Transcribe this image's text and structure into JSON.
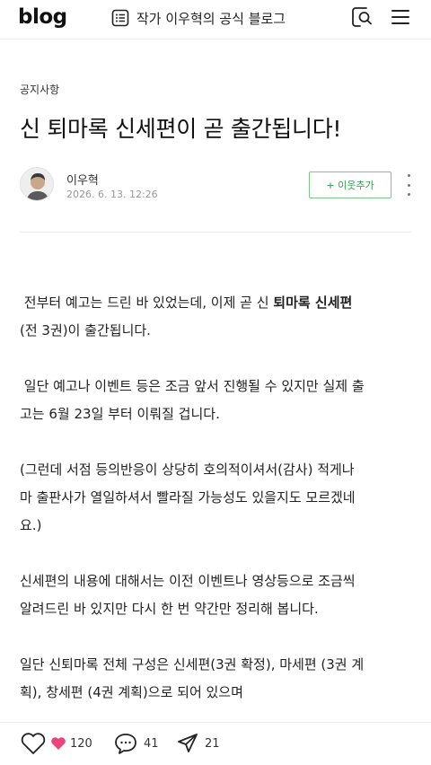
{
  "header": {
    "logo": "blog",
    "blog_title": "작가 이우혁의 공식 블로그"
  },
  "post": {
    "category": "공지사항",
    "title": "신 퇴마록 신세편이 곧 출간됩니다!",
    "author": "이우혁",
    "date": "2026. 6. 13. 12:26",
    "neighbor_button": "+ 이웃추가"
  },
  "body": {
    "p1_l1_a": " 전부터 예고는 드린 바 있었는데, 이제 곧 신 ",
    "p1_l1_b": "퇴마록 신세편",
    "p1_l2": "(전 3권)이 출간됩니다.",
    "p2_l1": " 일단 예고나 이벤트 등은 조금 앞서 진행될 수 있지만 실제 출",
    "p2_l2": "고는 6월 23일 부터 이뤄질 겁니다.",
    "p3_l1": "(그런데 서점 등의반응이 상당히 호의적이셔서(감사) 적게나",
    "p3_l2": "마 출판사가 열일하셔서 빨라질 가능성도 있을지도 모르겠네",
    "p3_l3": "요.)",
    "p4_l1": "신세편의 내용에 대해서는 이전 이벤트나 영상등으로 조금씩",
    "p4_l2": "알려드린 바 있지만 다시 한 번 약간만 정리해 봅니다.",
    "p5_l1": "일단 신퇴마록 전체 구성은 신세편(3권 확정), 마세편 (3권 계",
    "p5_l2": "획), 창세편 (4권 계획)으로 되어 있으며"
  },
  "bottom_bar": {
    "likes": "120",
    "comments": "41",
    "shares": "21"
  },
  "colors": {
    "accent_green": "#2a9d45",
    "heart_pink": "#e8467c"
  }
}
